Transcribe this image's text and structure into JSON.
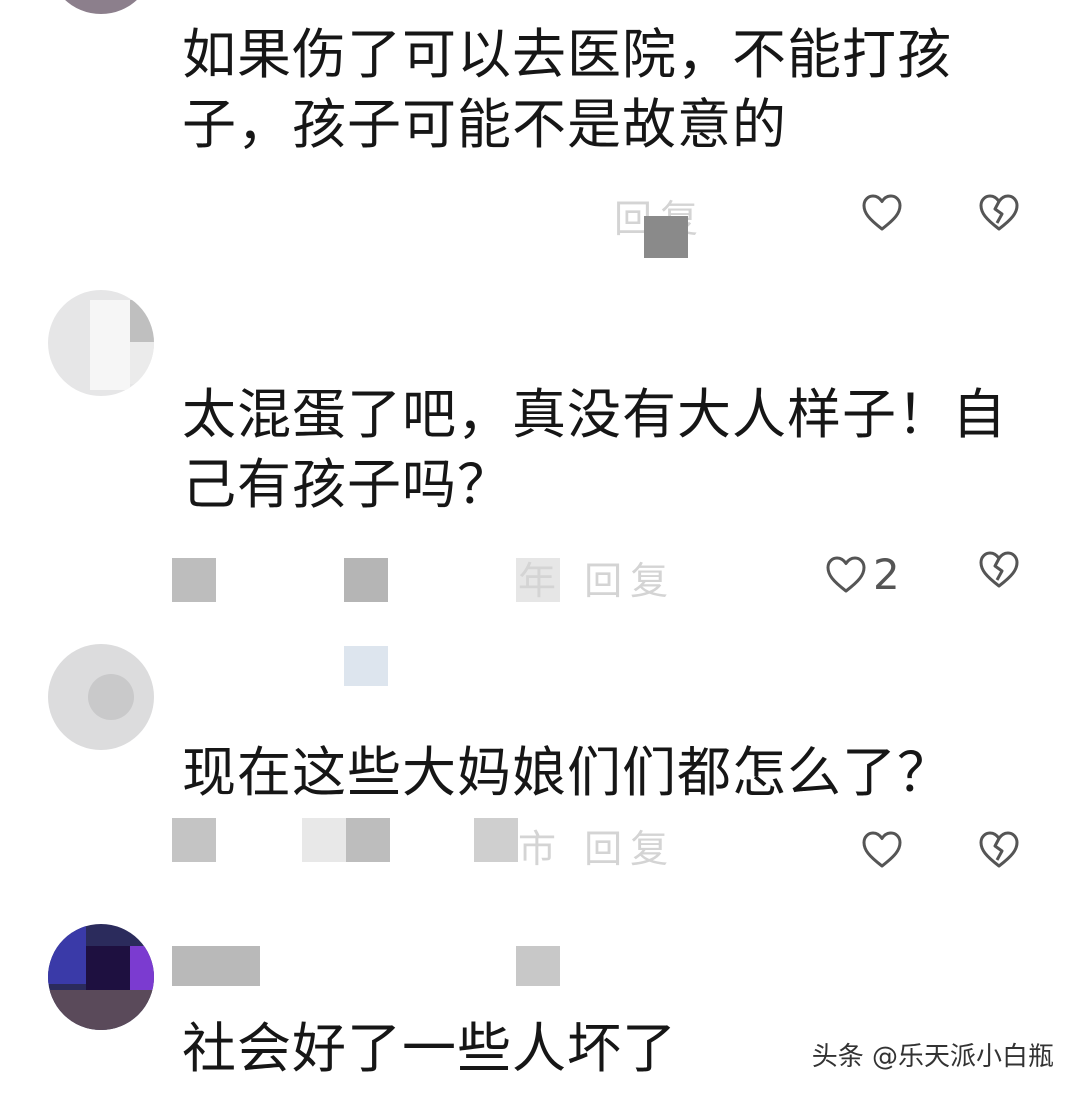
{
  "comments": [
    {
      "text": "如果伤了可以去医院，不能打孩子，孩子可能不是故意的",
      "meta_ghost": "回复",
      "likes": ""
    },
    {
      "text": "太混蛋了吧，真没有大人样子！自己有孩子吗？",
      "meta_ghost": "年 回复",
      "likes": "2"
    },
    {
      "text": "现在这些大妈娘们们都怎么了？",
      "meta_ghost": "市 回复",
      "likes": ""
    },
    {
      "text": "社会好了一些人坏了",
      "meta_ghost": "",
      "likes": ""
    }
  ],
  "icons": {
    "like": "heart-outline-icon",
    "dislike": "broken-heart-icon"
  },
  "colors": {
    "text": "#161616",
    "icon": "#555555",
    "mosaic_gray": "#bdbdbd"
  },
  "watermark": "头条 @乐天派小白瓶"
}
